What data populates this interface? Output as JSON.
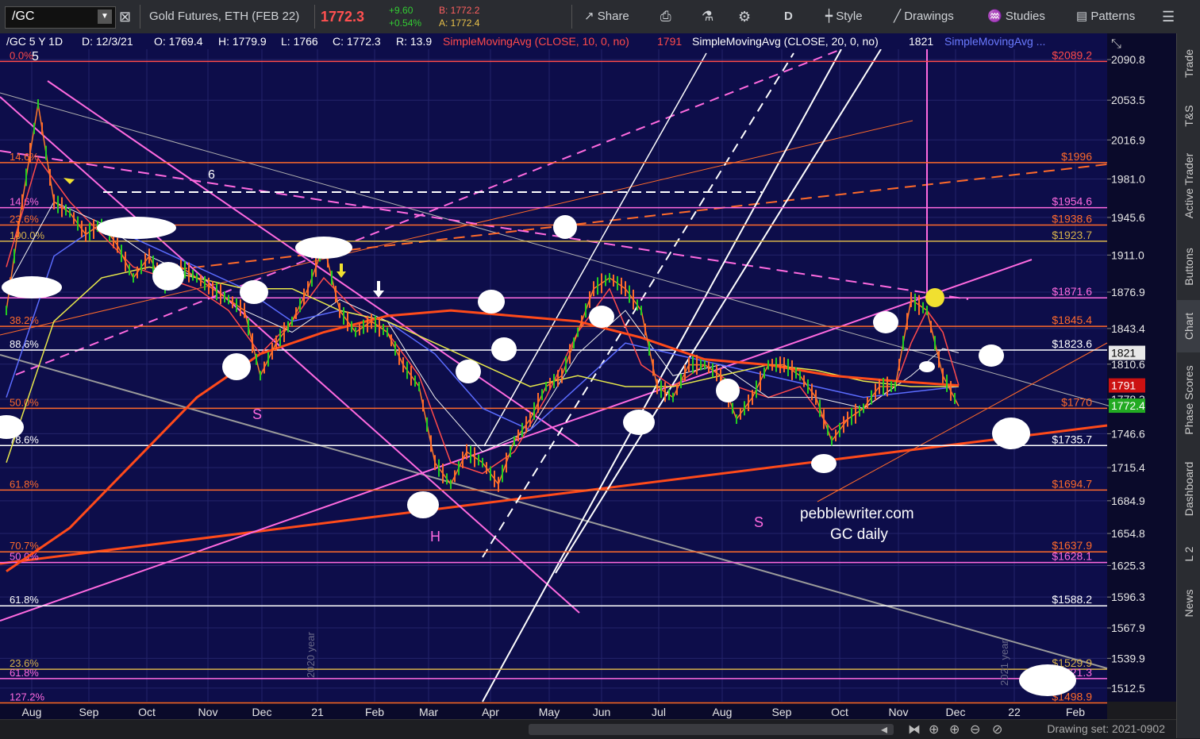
{
  "toolbar": {
    "symbol": "/GC",
    "description": "Gold Futures, ETH (FEB 22)",
    "last": "1772.3",
    "change": "+9.60",
    "change_pct": "+0.54%",
    "bid": "B: 1772.2",
    "ask": "A: 1772.4",
    "share": "Share",
    "aggregation": "D",
    "style": "Style",
    "drawings": "Drawings",
    "studies": "Studies",
    "patterns": "Patterns"
  },
  "sidebar": {
    "tabs": [
      "Trade",
      "T&S",
      "Active Trader",
      "Buttons",
      "Chart",
      "Phase Scores",
      "Dashboard",
      "L 2",
      "News"
    ]
  },
  "status": {
    "drawing_set": "Drawing set: 2021-0902"
  },
  "colors": {
    "background": "#0d0d4a",
    "sma10": "#ff4a4a",
    "sma20": "#f0f0f0",
    "sma50": "#5b6cff",
    "sma100": "#e8e84a",
    "sma200": "#ff4a1a",
    "fib_gold": "#d7b24a",
    "magenta": "#ff6ae0",
    "orange": "#ff6a2a"
  },
  "chart_data": {
    "type": "line",
    "header": {
      "title": "/GC 5 Y 1D",
      "date": "D: 12/3/21",
      "open": "O: 1769.4",
      "high": "H: 1779.9",
      "low": "L: 1766",
      "close": "C: 1772.3",
      "range": "R: 13.9",
      "sma10_label": "SimpleMovingAvg (CLOSE, 10, 0, no)",
      "sma10_val": "1791",
      "sma20_label": "SimpleMovingAvg (CLOSE, 20, 0, no)",
      "sma20_val": "1821",
      "sma_more": "SimpleMovingAvg ..."
    },
    "y_axis": {
      "ticks": [
        2090.8,
        2053.5,
        2016.9,
        1981,
        1945.6,
        1911,
        1876.9,
        1843.4,
        1810.6,
        1778.3,
        1746.6,
        1715.4,
        1684.9,
        1654.8,
        1625.3,
        1596.3,
        1567.9,
        1539.9,
        1512.5
      ],
      "range": [
        1500,
        2115
      ],
      "badges": [
        {
          "label": "1821",
          "value": 1821,
          "color": "#e8e8e8",
          "text": "#000"
        },
        {
          "label": "1791",
          "value": 1791,
          "color": "#cc1111",
          "text": "#fff"
        },
        {
          "label": "1772.4",
          "value": 1772.4,
          "color": "#22aa22",
          "text": "#fff"
        }
      ]
    },
    "x_axis": {
      "labels": [
        "Aug",
        "Sep",
        "Oct",
        "Nov",
        "Dec",
        "21",
        "Feb",
        "Mar",
        "Apr",
        "May",
        "Jun",
        "Jul",
        "Aug",
        "Sep",
        "Oct",
        "Nov",
        "Dec",
        "22",
        "Feb"
      ],
      "positions": [
        40,
        112,
        185,
        262,
        330,
        400,
        472,
        540,
        618,
        692,
        758,
        830,
        910,
        985,
        1058,
        1132,
        1204,
        1278,
        1355
      ]
    },
    "price_levels": [
      {
        "label": "$2089.2",
        "value": 2089.2,
        "color": "#ff4a4a"
      },
      {
        "label": "$1996",
        "value": 1996,
        "color": "#ff6a2a"
      },
      {
        "label": "$1954.6",
        "value": 1954.6,
        "color": "#ff6ae0"
      },
      {
        "label": "$1938.6",
        "value": 1938.6,
        "color": "#ff6a2a"
      },
      {
        "label": "$1923.7",
        "value": 1923.7,
        "color": "#d7b24a"
      },
      {
        "label": "$1871.6",
        "value": 1871.6,
        "color": "#ff6ae0"
      },
      {
        "label": "$1845.4",
        "value": 1845.4,
        "color": "#ff6a2a"
      },
      {
        "label": "$1823.6",
        "value": 1823.6,
        "color": "#ffffff"
      },
      {
        "label": "$1770",
        "value": 1770,
        "color": "#ff6a2a"
      },
      {
        "label": "$1735.7",
        "value": 1735.7,
        "color": "#ffffff"
      },
      {
        "label": "$1694.7",
        "value": 1694.7,
        "color": "#ff6a2a"
      },
      {
        "label": "$1637.9",
        "value": 1637.9,
        "color": "#ff6a2a"
      },
      {
        "label": "$1628.1",
        "value": 1628.1,
        "color": "#ff6ae0"
      },
      {
        "label": "$1588.2",
        "value": 1588.2,
        "color": "#ffffff"
      },
      {
        "label": "$1529.9",
        "value": 1529.9,
        "color": "#d7b24a"
      },
      {
        "label": "$1521.3",
        "value": 1521.3,
        "color": "#ff6ae0"
      },
      {
        "label": "$1498.9",
        "value": 1498.9,
        "color": "#ff6a2a"
      }
    ],
    "fib_labels": [
      {
        "label": "0.0%",
        "value": 2089.2,
        "color": "#ff4a4a"
      },
      {
        "label": "14.6%",
        "value": 1996,
        "color": "#ff6a2a"
      },
      {
        "label": "14.6%",
        "value": 1954.6,
        "color": "#ff6ae0"
      },
      {
        "label": "23.6%",
        "value": 1938.6,
        "color": "#ff6a2a"
      },
      {
        "label": "100.0%",
        "value": 1923.7,
        "color": "#d7b24a"
      },
      {
        "label": "23.6%",
        "value": 1871.6,
        "color": "#ff6ae0"
      },
      {
        "label": "38.2%",
        "value": 1845.4,
        "color": "#ff6a2a"
      },
      {
        "label": "88.6%",
        "value": 1823.6,
        "color": "#ffffff"
      },
      {
        "label": "50.0%",
        "value": 1770,
        "color": "#ff6a2a"
      },
      {
        "label": "78.6%",
        "value": 1735.7,
        "color": "#ffffff"
      },
      {
        "label": "61.8%",
        "value": 1694.7,
        "color": "#ff6a2a"
      },
      {
        "label": "70.7%",
        "value": 1637.9,
        "color": "#ff6a2a"
      },
      {
        "label": "50.0%",
        "value": 1628.1,
        "color": "#ff6ae0"
      },
      {
        "label": "61.8%",
        "value": 1588.2,
        "color": "#ffffff"
      },
      {
        "label": "23.6%",
        "value": 1529.9,
        "color": "#d7b24a"
      },
      {
        "label": "61.8%",
        "value": 1521.3,
        "color": "#ff6ae0"
      },
      {
        "label": "127.2%",
        "value": 1498.9,
        "color": "#ff6ae0"
      }
    ],
    "annotations": [
      "5",
      "6",
      "S",
      "H",
      "S",
      "pebblewriter.com",
      "GC daily",
      "2020 year",
      "2021 year"
    ],
    "price": {
      "x": [
        0,
        20,
        40,
        60,
        80,
        100,
        120,
        140,
        160,
        180,
        200,
        220,
        240,
        260,
        280,
        300,
        320,
        340,
        360,
        380,
        400,
        420,
        440,
        460,
        480,
        500,
        520,
        540,
        560,
        580,
        600,
        620,
        640,
        660,
        680,
        700,
        720,
        740,
        760,
        780,
        800,
        820,
        840,
        860,
        880,
        900,
        920,
        940,
        960,
        980,
        1000,
        1020,
        1040,
        1060,
        1080,
        1100,
        1120,
        1140,
        1160,
        1180,
        1200
      ],
      "y": [
        1860,
        1960,
        2050,
        1960,
        1950,
        1930,
        1940,
        1920,
        1890,
        1910,
        1880,
        1900,
        1890,
        1880,
        1870,
        1860,
        1800,
        1830,
        1850,
        1880,
        1920,
        1860,
        1840,
        1850,
        1840,
        1810,
        1790,
        1720,
        1700,
        1730,
        1720,
        1700,
        1740,
        1760,
        1790,
        1800,
        1840,
        1880,
        1890,
        1880,
        1860,
        1790,
        1780,
        1810,
        1810,
        1800,
        1760,
        1780,
        1810,
        1810,
        1800,
        1780,
        1740,
        1760,
        1770,
        1790,
        1790,
        1870,
        1860,
        1800,
        1772
      ]
    },
    "sma_lines": [
      {
        "name": "SMA10",
        "color": "#ff4a4a",
        "width": 1.5,
        "x": [
          0,
          40,
          80,
          120,
          160,
          200,
          240,
          280,
          320,
          360,
          400,
          440,
          480,
          520,
          560,
          600,
          640,
          680,
          720,
          760,
          800,
          840,
          880,
          920,
          960,
          1000,
          1040,
          1080,
          1120,
          1140,
          1160,
          1180,
          1200
        ],
        "y": [
          1900,
          2000,
          1960,
          1930,
          1900,
          1890,
          1880,
          1860,
          1820,
          1850,
          1890,
          1860,
          1840,
          1800,
          1720,
          1710,
          1730,
          1780,
          1840,
          1880,
          1810,
          1790,
          1810,
          1790,
          1780,
          1790,
          1750,
          1770,
          1790,
          1830,
          1860,
          1840,
          1791
        ]
      },
      {
        "name": "SMA20",
        "color": "#f0f0f0",
        "width": 1,
        "x": [
          0,
          60,
          120,
          180,
          240,
          300,
          360,
          420,
          480,
          540,
          600,
          660,
          720,
          780,
          840,
          900,
          960,
          1020,
          1080,
          1140,
          1180,
          1200
        ],
        "y": [
          1880,
          1960,
          1940,
          1910,
          1890,
          1860,
          1840,
          1870,
          1850,
          1780,
          1730,
          1750,
          1820,
          1860,
          1800,
          1810,
          1780,
          1780,
          1770,
          1800,
          1825,
          1821
        ]
      },
      {
        "name": "SMA50",
        "color": "#5b6cff",
        "width": 1.5,
        "x": [
          0,
          60,
          120,
          180,
          240,
          300,
          360,
          420,
          480,
          540,
          600,
          660,
          720,
          780,
          840,
          900,
          960,
          1020,
          1080,
          1140,
          1200
        ],
        "y": [
          1780,
          1910,
          1940,
          1920,
          1900,
          1880,
          1850,
          1860,
          1850,
          1820,
          1770,
          1750,
          1790,
          1830,
          1820,
          1810,
          1800,
          1790,
          1780,
          1785,
          1790
        ]
      },
      {
        "name": "SMA100",
        "color": "#e8e84a",
        "width": 1.5,
        "x": [
          0,
          60,
          120,
          180,
          240,
          300,
          360,
          420,
          480,
          540,
          600,
          660,
          720,
          780,
          840,
          900,
          960,
          1020,
          1080,
          1140,
          1200
        ],
        "y": [
          1720,
          1850,
          1890,
          1900,
          1890,
          1880,
          1880,
          1860,
          1850,
          1830,
          1810,
          1790,
          1800,
          1790,
          1790,
          1800,
          1810,
          1805,
          1795,
          1790,
          1790
        ]
      },
      {
        "name": "SMA200",
        "color": "#ff4a1a",
        "width": 3,
        "x": [
          0,
          80,
          160,
          240,
          320,
          400,
          480,
          560,
          640,
          720,
          800,
          880,
          960,
          1040,
          1120,
          1200
        ],
        "y": [
          1620,
          1660,
          1720,
          1780,
          1820,
          1840,
          1855,
          1860,
          1855,
          1850,
          1835,
          1815,
          1810,
          1800,
          1795,
          1791
        ]
      }
    ]
  }
}
